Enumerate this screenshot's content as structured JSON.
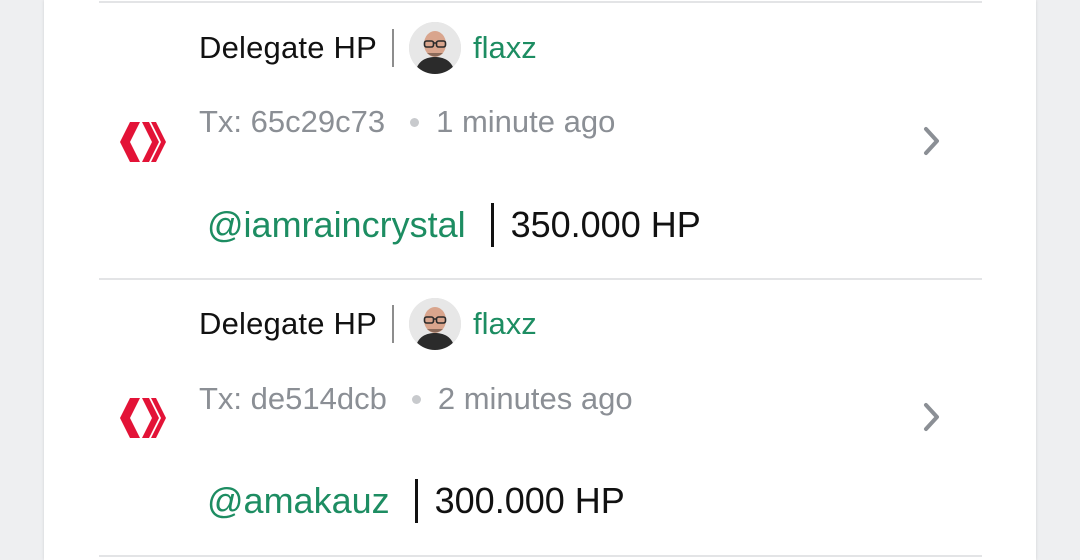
{
  "colors": {
    "accent_green": "#1d8d62",
    "hive_red": "#e31337",
    "muted_text": "#8b8f95"
  },
  "transactions": [
    {
      "icon": "hive-logo-icon",
      "operation": "Delegate HP",
      "username": "flaxz",
      "tx_label": "Tx: 65c29c73",
      "time_ago": "1 minute ago",
      "recipient": "@iamraincrystal",
      "amount": "350.000 HP"
    },
    {
      "icon": "hive-logo-icon",
      "operation": "Delegate HP",
      "username": "flaxz",
      "tx_label": "Tx: de514dcb",
      "time_ago": "2 minutes ago",
      "recipient": "@amakauz",
      "amount": "300.000 HP"
    }
  ]
}
